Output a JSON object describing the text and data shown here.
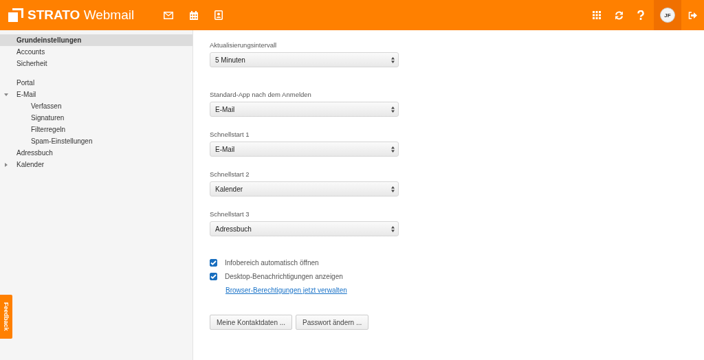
{
  "header": {
    "logo": "**STRATO** Webmail",
    "avatar": "JF"
  },
  "sidebar": {
    "groups": [
      [
        {
          "label": "Grundeinstellungen",
          "selected": true
        },
        {
          "label": "Accounts",
          "selected": false
        },
        {
          "label": "Sicherheit",
          "selected": false
        }
      ],
      [
        {
          "label": "Portal",
          "selected": false
        },
        {
          "label": "E-Mail",
          "selected": false,
          "expanded": true,
          "children": [
            {
              "label": "Verfassen",
              "selected": false
            },
            {
              "label": "Signaturen",
              "selected": false
            },
            {
              "label": "Filterregeln",
              "selected": false
            },
            {
              "label": "Spam-Einstellungen",
              "selected": false
            }
          ]
        },
        {
          "label": "Adressbuch",
          "selected": false
        },
        {
          "label": "Kalender",
          "selected": false,
          "expanded": false
        }
      ]
    ]
  },
  "settings": {
    "selects": [
      {
        "label": "Aktualisierungsintervall",
        "value": "5 Minuten"
      },
      {
        "label": "Standard-App nach dem Anmelden",
        "value": "E-Mail"
      },
      {
        "label": "Schnellstart 1",
        "value": "E-Mail"
      },
      {
        "label": "Schnellstart 2",
        "value": "Kalender"
      },
      {
        "label": "Schnellstart 3",
        "value": "Adressbuch"
      }
    ],
    "checkboxes": [
      {
        "label": "Infobereich automatisch öffnen",
        "checked": true
      },
      {
        "label": "Desktop-Benachrichtigungen anzeigen",
        "checked": true
      }
    ],
    "link": "Browser-Berechtigungen jetzt verwalten",
    "buttons": [
      "Meine Kontaktdaten ...",
      "Passwort ändern ..."
    ]
  },
  "feedback": "Feedback"
}
